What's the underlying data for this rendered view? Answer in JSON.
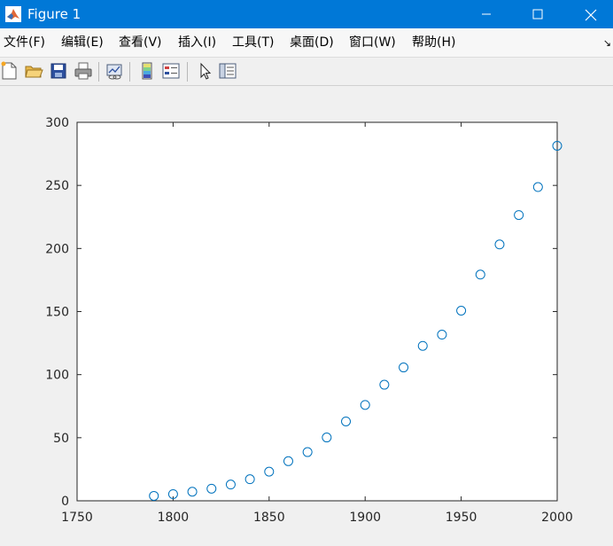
{
  "window": {
    "title": "Figure 1"
  },
  "menu": {
    "items": [
      "文件(F)",
      "编辑(E)",
      "查看(V)",
      "插入(I)",
      "工具(T)",
      "桌面(D)",
      "窗口(W)",
      "帮助(H)"
    ],
    "overflow_glyph": "↘"
  },
  "toolbar": {
    "tools": [
      "new-figure-icon",
      "open-file-icon",
      "save-icon",
      "print-icon",
      "link-plot-icon",
      "insert-colorbar-icon",
      "insert-legend-icon",
      "edit-plot-pointer-icon",
      "property-inspector-icon"
    ]
  },
  "colors": {
    "titlebar": "#0078d7",
    "marker": "#0072bd",
    "axes_background": "#ffffff",
    "figure_background": "#f0f0f0"
  },
  "chart_data": {
    "type": "scatter",
    "title": "",
    "xlabel": "",
    "ylabel": "",
    "xlim": [
      1750,
      2000
    ],
    "ylim": [
      0,
      300
    ],
    "xticks": [
      1750,
      1800,
      1850,
      1900,
      1950,
      2000
    ],
    "yticks": [
      0,
      50,
      100,
      150,
      200,
      250,
      300
    ],
    "marker": "circle",
    "grid": false,
    "series": [
      {
        "x": [
          1790,
          1800,
          1810,
          1820,
          1830,
          1840,
          1850,
          1860,
          1870,
          1880,
          1890,
          1900,
          1910,
          1920,
          1930,
          1940,
          1950,
          1960,
          1970,
          1980,
          1990,
          2000
        ],
        "y": [
          3.9,
          5.3,
          7.2,
          9.6,
          12.9,
          17.1,
          23.1,
          31.4,
          38.6,
          50.2,
          62.9,
          76.0,
          92.0,
          105.7,
          122.8,
          131.7,
          150.7,
          179.3,
          203.2,
          226.5,
          248.7,
          281.4
        ]
      }
    ]
  }
}
